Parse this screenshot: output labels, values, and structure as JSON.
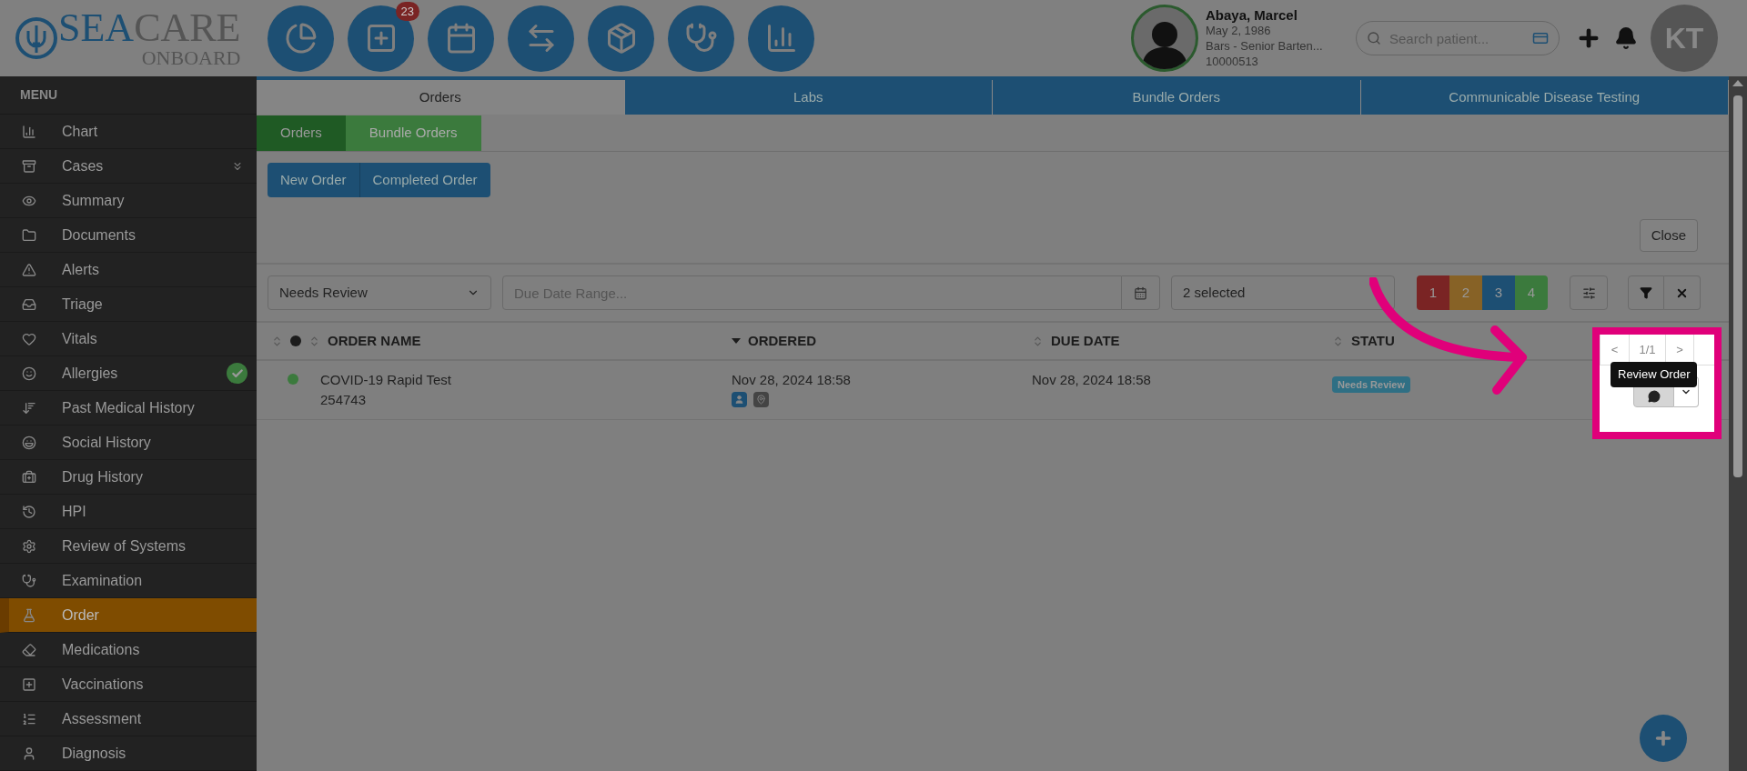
{
  "logo": {
    "primary": "SEA",
    "secondary": "CARE",
    "tagline": "ONBOARD"
  },
  "toolbar": {
    "notification_count": "23"
  },
  "patient": {
    "name": "Abaya, Marcel",
    "dob": "May 2, 1986",
    "role": "Bars - Senior Barten...",
    "id": "10000513"
  },
  "search": {
    "placeholder": "Search patient..."
  },
  "user": {
    "initials": "KT"
  },
  "sidebar": {
    "title": "MENU",
    "items": [
      {
        "label": "Chart",
        "selected": false,
        "expandable": false,
        "done": false
      },
      {
        "label": "Cases",
        "selected": false,
        "expandable": true,
        "done": false
      },
      {
        "label": "Summary",
        "selected": false,
        "expandable": false,
        "done": false
      },
      {
        "label": "Documents",
        "selected": false,
        "expandable": false,
        "done": false
      },
      {
        "label": "Alerts",
        "selected": false,
        "expandable": false,
        "done": false
      },
      {
        "label": "Triage",
        "selected": false,
        "expandable": false,
        "done": false
      },
      {
        "label": "Vitals",
        "selected": false,
        "expandable": false,
        "done": false
      },
      {
        "label": "Allergies",
        "selected": false,
        "expandable": false,
        "done": true
      },
      {
        "label": "Past Medical History",
        "selected": false,
        "expandable": false,
        "done": false
      },
      {
        "label": "Social History",
        "selected": false,
        "expandable": false,
        "done": false
      },
      {
        "label": "Drug History",
        "selected": false,
        "expandable": false,
        "done": false
      },
      {
        "label": "HPI",
        "selected": false,
        "expandable": false,
        "done": false
      },
      {
        "label": "Review of Systems",
        "selected": false,
        "expandable": false,
        "done": false
      },
      {
        "label": "Examination",
        "selected": false,
        "expandable": false,
        "done": false
      },
      {
        "label": "Order",
        "selected": true,
        "expandable": false,
        "done": false
      },
      {
        "label": "Medications",
        "selected": false,
        "expandable": false,
        "done": false
      },
      {
        "label": "Vaccinations",
        "selected": false,
        "expandable": false,
        "done": false
      },
      {
        "label": "Assessment",
        "selected": false,
        "expandable": false,
        "done": false
      },
      {
        "label": "Diagnosis",
        "selected": false,
        "expandable": false,
        "done": false
      }
    ]
  },
  "tabs": [
    {
      "label": "Orders",
      "selected": true
    },
    {
      "label": "Labs",
      "selected": false
    },
    {
      "label": "Bundle Orders",
      "selected": false
    },
    {
      "label": "Communicable Disease Testing",
      "selected": false
    }
  ],
  "subtabs": [
    {
      "label": "Orders",
      "selected": true
    },
    {
      "label": "Bundle Orders",
      "selected": false
    }
  ],
  "actions": [
    "New Order",
    "Completed Order"
  ],
  "close_button": "Close",
  "filters": {
    "status": "Needs Review",
    "date_range": {
      "placeholder": "Due Date Range..."
    },
    "types": "2 selected",
    "priorities": [
      {
        "label": "1",
        "color": "#7a2424"
      },
      {
        "label": "2",
        "color": "#876226"
      },
      {
        "label": "3",
        "color": "#1d4f73"
      },
      {
        "label": "4",
        "color": "#3b7a3d"
      }
    ]
  },
  "table": {
    "columns": [
      {
        "label": "ORDER NAME",
        "sorted": false
      },
      {
        "label": "ORDERED",
        "sorted": true
      },
      {
        "label": "DUE DATE",
        "sorted": false
      },
      {
        "label": "STATU",
        "sorted": false
      }
    ],
    "rows": [
      {
        "color": "#3b7a3d",
        "name": "COVID-19 Rapid Test",
        "number": "254743",
        "ordered": "Nov 28, 2024 18:58",
        "due": "Nov 28, 2024 18:58",
        "status": "Needs Review"
      }
    ]
  },
  "pagination": {
    "previous": "<",
    "page": "1/1",
    "next": ">"
  },
  "tooltip": "Review Order"
}
